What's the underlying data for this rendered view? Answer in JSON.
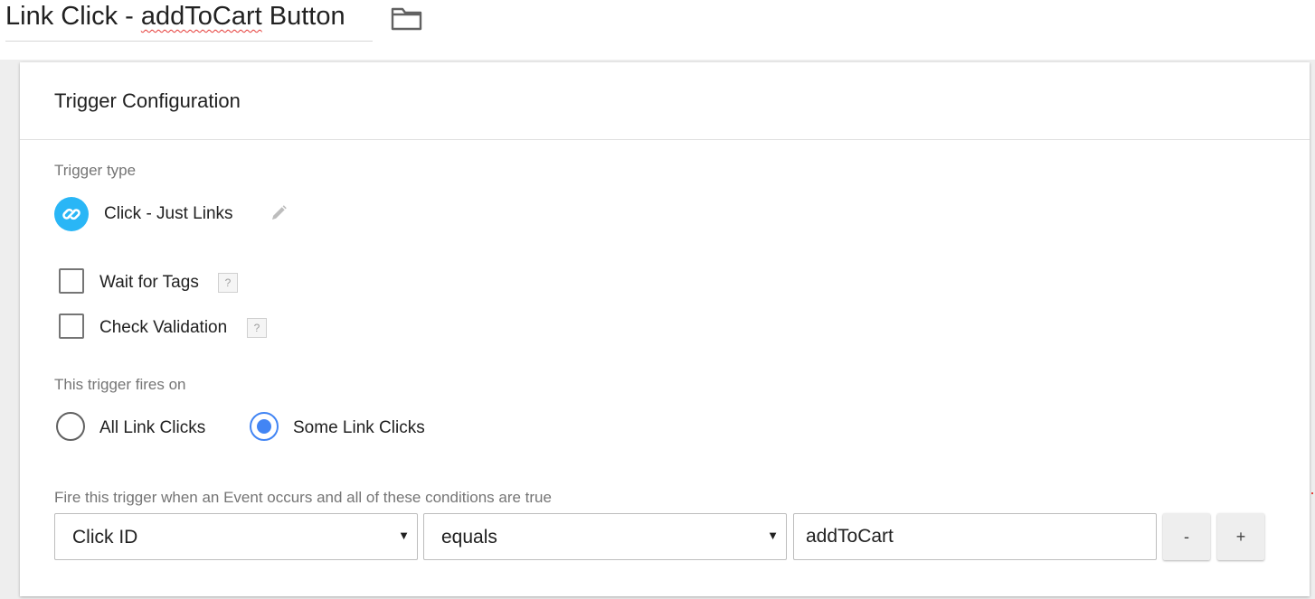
{
  "header": {
    "title_prefix": "Link Click - ",
    "title_misspelled": "addToCart",
    "title_suffix": " Button",
    "folder_icon": "folder-icon"
  },
  "card": {
    "title": "Trigger Configuration",
    "trigger_type": {
      "label": "Trigger type",
      "name": "Click - Just Links",
      "icon": "link-icon",
      "icon_color": "#29b6f6",
      "edit_icon": "pencil-icon"
    },
    "options": [
      {
        "label": "Wait for Tags",
        "checked": false,
        "help": "?"
      },
      {
        "label": "Check Validation",
        "checked": false,
        "help": "?"
      }
    ],
    "fires_on": {
      "label": "This trigger fires on",
      "options": [
        {
          "label": "All Link Clicks",
          "selected": false
        },
        {
          "label": "Some Link Clicks",
          "selected": true
        }
      ],
      "accent": "#4285f4"
    },
    "conditions": {
      "label": "Fire this trigger when an Event occurs and all of these conditions are true",
      "variable": "Click ID",
      "operator": "equals",
      "value": "addToCart",
      "remove_label": "-",
      "add_label": "+"
    }
  }
}
